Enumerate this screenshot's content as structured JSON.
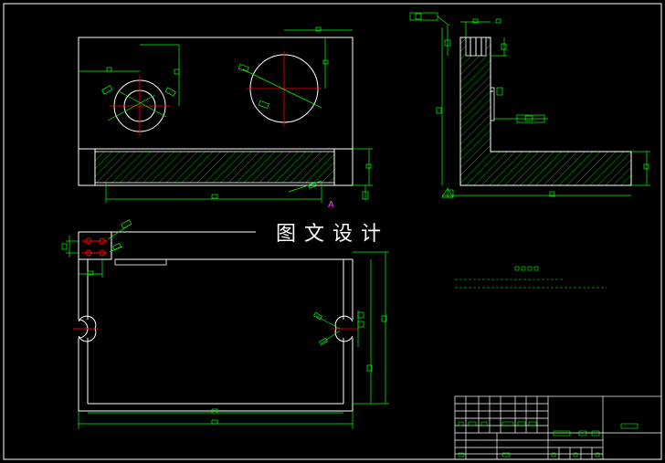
{
  "watermark": "图文设计",
  "section_marker": "A",
  "colors": {
    "background": "#000000",
    "outline": "#ffffff",
    "dimension": "#00ff00",
    "centerline": "#ff0000",
    "hatch": "#00ff00",
    "marker": "#ff3cff"
  }
}
